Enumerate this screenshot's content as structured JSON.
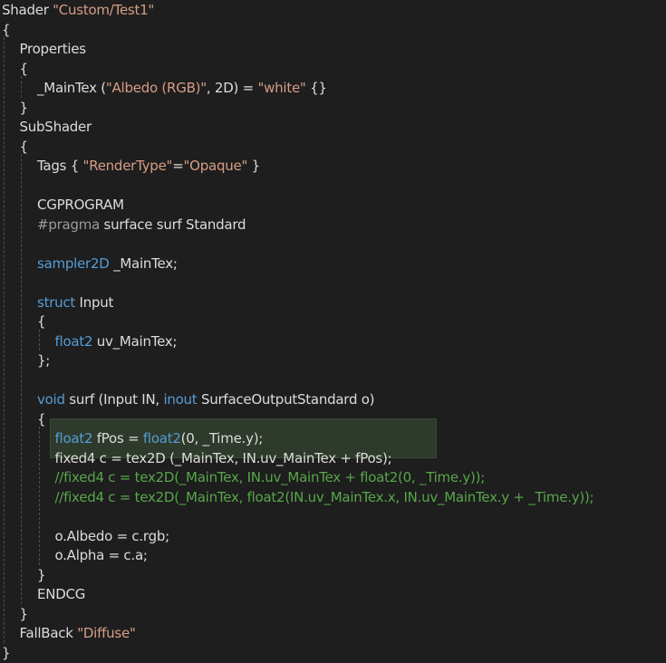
{
  "editor": {
    "lines": [
      {
        "indent": 0,
        "tokens": [
          {
            "t": "Shader ",
            "c": "p"
          },
          {
            "t": "\"Custom/Test1\"",
            "c": "str"
          }
        ]
      },
      {
        "indent": 0,
        "tokens": [
          {
            "t": "{",
            "c": "p"
          }
        ]
      },
      {
        "indent": 1,
        "tokens": [
          {
            "t": "Properties",
            "c": "p"
          }
        ]
      },
      {
        "indent": 1,
        "tokens": [
          {
            "t": "{",
            "c": "p"
          }
        ]
      },
      {
        "indent": 2,
        "tokens": [
          {
            "t": "_MainTex (",
            "c": "p"
          },
          {
            "t": "\"Albedo (RGB)\"",
            "c": "str"
          },
          {
            "t": ", 2D) = ",
            "c": "p"
          },
          {
            "t": "\"white\"",
            "c": "str"
          },
          {
            "t": " {}",
            "c": "p"
          }
        ]
      },
      {
        "indent": 1,
        "tokens": [
          {
            "t": "}",
            "c": "p"
          }
        ]
      },
      {
        "indent": 1,
        "tokens": [
          {
            "t": "SubShader",
            "c": "p"
          }
        ]
      },
      {
        "indent": 1,
        "tokens": [
          {
            "t": "{",
            "c": "p"
          }
        ]
      },
      {
        "indent": 2,
        "tokens": [
          {
            "t": "Tags { ",
            "c": "p"
          },
          {
            "t": "\"RenderType\"",
            "c": "str"
          },
          {
            "t": "=",
            "c": "p"
          },
          {
            "t": "\"Opaque\"",
            "c": "str"
          },
          {
            "t": " }",
            "c": "p"
          }
        ]
      },
      {
        "indent": 2,
        "tokens": []
      },
      {
        "indent": 2,
        "tokens": [
          {
            "t": "CGPROGRAM",
            "c": "p"
          }
        ]
      },
      {
        "indent": 2,
        "tokens": [
          {
            "t": "#pragma",
            "c": "pp"
          },
          {
            "t": " surface surf Standard",
            "c": "p"
          }
        ]
      },
      {
        "indent": 2,
        "tokens": []
      },
      {
        "indent": 2,
        "tokens": [
          {
            "t": "sampler2D",
            "c": "kw"
          },
          {
            "t": " _MainTex;",
            "c": "p"
          }
        ]
      },
      {
        "indent": 2,
        "tokens": []
      },
      {
        "indent": 2,
        "tokens": [
          {
            "t": "struct",
            "c": "kw"
          },
          {
            "t": " Input",
            "c": "p"
          }
        ]
      },
      {
        "indent": 2,
        "tokens": [
          {
            "t": "{",
            "c": "p"
          }
        ]
      },
      {
        "indent": 3,
        "tokens": [
          {
            "t": "float2",
            "c": "kw"
          },
          {
            "t": " uv_MainTex;",
            "c": "p"
          }
        ]
      },
      {
        "indent": 2,
        "tokens": [
          {
            "t": "};",
            "c": "p"
          }
        ]
      },
      {
        "indent": 2,
        "tokens": []
      },
      {
        "indent": 2,
        "tokens": [
          {
            "t": "void",
            "c": "kw"
          },
          {
            "t": " surf (Input IN, ",
            "c": "p"
          },
          {
            "t": "inout",
            "c": "kw"
          },
          {
            "t": " SurfaceOutputStandard o)",
            "c": "p"
          }
        ]
      },
      {
        "indent": 2,
        "tokens": [
          {
            "t": "{",
            "c": "p"
          }
        ]
      },
      {
        "indent": 3,
        "tokens": [
          {
            "t": "float2",
            "c": "kw"
          },
          {
            "t": " fPos = ",
            "c": "p"
          },
          {
            "t": "float2",
            "c": "kw"
          },
          {
            "t": "(0, _Time.y);",
            "c": "p"
          }
        ]
      },
      {
        "indent": 3,
        "tokens": [
          {
            "t": "fixed4 c = tex2D (_MainTex, IN.uv_MainTex + fPos);",
            "c": "p"
          }
        ]
      },
      {
        "indent": 3,
        "tokens": [
          {
            "t": "//fixed4 c = tex2D(_MainTex, IN.uv_MainTex + float2(0, _Time.y));",
            "c": "cm"
          }
        ]
      },
      {
        "indent": 3,
        "tokens": [
          {
            "t": "//fixed4 c = tex2D(_MainTex, float2(IN.uv_MainTex.x, IN.uv_MainTex.y + _Time.y));",
            "c": "cm"
          }
        ]
      },
      {
        "indent": 3,
        "tokens": []
      },
      {
        "indent": 3,
        "tokens": [
          {
            "t": "o.Albedo = c.rgb;",
            "c": "p"
          }
        ]
      },
      {
        "indent": 3,
        "tokens": [
          {
            "t": "o.Alpha = c.a;",
            "c": "p"
          }
        ]
      },
      {
        "indent": 2,
        "tokens": [
          {
            "t": "}",
            "c": "p"
          }
        ]
      },
      {
        "indent": 2,
        "tokens": [
          {
            "t": "ENDCG",
            "c": "p"
          }
        ]
      },
      {
        "indent": 1,
        "tokens": [
          {
            "t": "}",
            "c": "p"
          }
        ]
      },
      {
        "indent": 1,
        "tokens": [
          {
            "t": "FallBack ",
            "c": "p"
          },
          {
            "t": "\"Diffuse\"",
            "c": "str"
          }
        ]
      },
      {
        "indent": 0,
        "tokens": [
          {
            "t": "}",
            "c": "p"
          }
        ]
      }
    ],
    "highlighted_lines": [
      22,
      23
    ],
    "colors": {
      "background": "#1e1e1e",
      "text": "#dcdcdc",
      "keyword": "#569cd6",
      "string": "#d69d85",
      "comment": "#57a64a",
      "preprocessor": "#9b9b9b",
      "highlight": "#2e3a2b"
    }
  }
}
